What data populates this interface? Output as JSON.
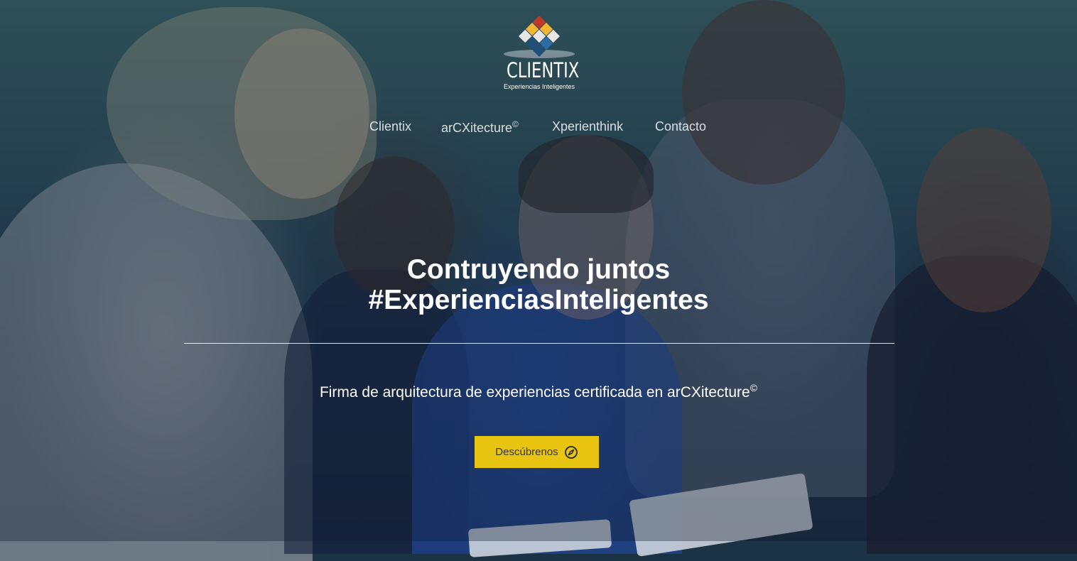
{
  "brand": {
    "name": "CLIENTIX",
    "tagline": "Experiencias Inteligentes",
    "logo_colors": [
      "#c0392b",
      "#f2b632",
      "#d8d8d8",
      "#1f4e79",
      "#2e6da4"
    ]
  },
  "nav": {
    "items": [
      {
        "label": "Clientix",
        "sup": ""
      },
      {
        "label": "arCXitecture",
        "sup": "©"
      },
      {
        "label": "Xperienthink",
        "sup": ""
      },
      {
        "label": "Contacto",
        "sup": ""
      }
    ]
  },
  "hero": {
    "headline_line1": "Contruyendo juntos",
    "headline_line2": "#ExperienciasInteligentes",
    "subheadline": "Firma de arquitectura de experiencias certificada en arCXitecture",
    "subheadline_sup": "©",
    "cta_label": "Descúbrenos",
    "cta_icon": "compass-icon",
    "accent_color": "#e8c511"
  }
}
